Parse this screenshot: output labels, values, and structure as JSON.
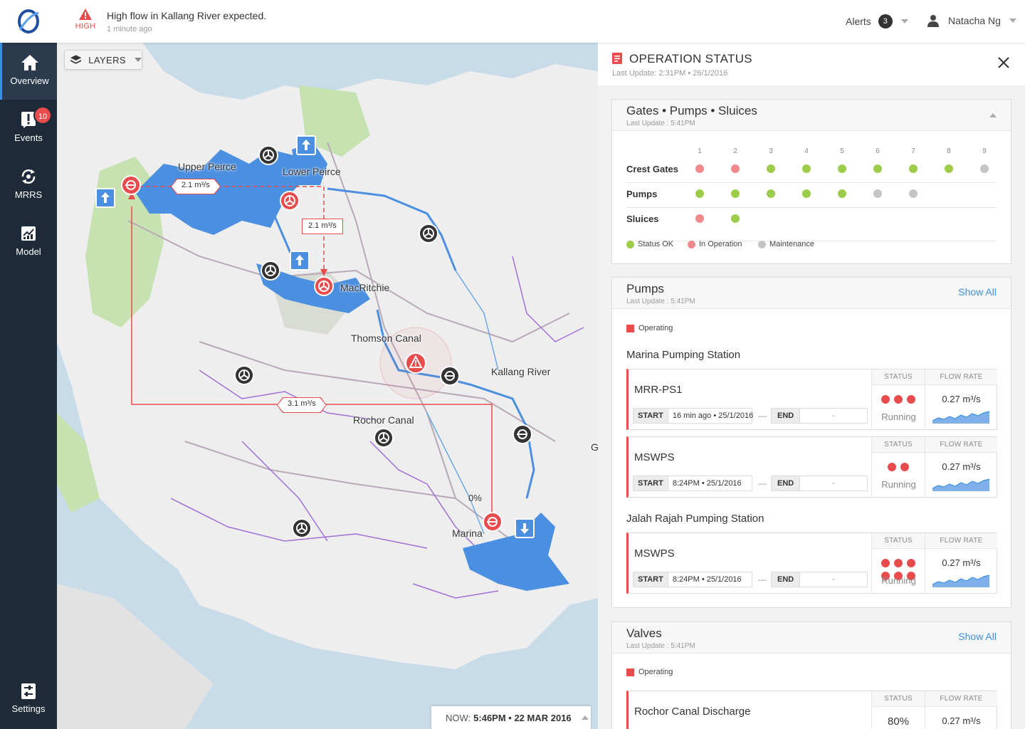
{
  "header": {
    "alert_level": "HIGH",
    "alert_message": "High flow in Kallang River expected.",
    "alert_time": "1 minute ago",
    "alerts_label": "Alerts",
    "alerts_count": "3",
    "user_name": "Natacha Ng"
  },
  "sidebar": {
    "items": [
      {
        "label": "Overview",
        "icon": "home-icon",
        "active": true
      },
      {
        "label": "Events",
        "icon": "exclamation-icon",
        "badge": "10"
      },
      {
        "label": "MRRS",
        "icon": "refresh-icon"
      },
      {
        "label": "Model",
        "icon": "bar-chart-icon"
      }
    ],
    "settings_label": "Settings"
  },
  "map": {
    "layers_label": "LAYERS",
    "places": {
      "upper_peirce": "Upper Peirce",
      "lower_peirce": "Lower Peirce",
      "macritchie": "MacRitchie",
      "thomson_canal": "Thomson Canal",
      "kallang_river": "Kallang River",
      "rochor_canal": "Rochor Canal",
      "marina": "Marina",
      "g_edge": "G"
    },
    "flows": {
      "flow1": "2.1 m³/s",
      "flow2": "2.1 m³/s",
      "flow3": "3.1 m³/s"
    },
    "percent": "0%",
    "now_label": "NOW:",
    "now_value": "5:46PM • 22 MAR 2016",
    "colors": {
      "water": "#4a8fe0",
      "land": "#eeeeee",
      "sea": "#c8dbe8",
      "park": "#c6e2b0",
      "alert": "#e84c4c"
    }
  },
  "panel": {
    "title": "OPERATION STATUS",
    "last_update": "Last Update: 2:31PM • 26/1/2016",
    "gps": {
      "title": "Gates • Pumps • Sluices",
      "update": "Last Update : 5:41PM",
      "columns": [
        "1",
        "2",
        "3",
        "4",
        "5",
        "6",
        "7",
        "8",
        "9"
      ],
      "rows": [
        {
          "label": "Crest Gates",
          "states": [
            "r",
            "r",
            "g",
            "g",
            "g",
            "g",
            "g",
            "g",
            "x"
          ]
        },
        {
          "label": "Pumps",
          "states": [
            "g",
            "g",
            "g",
            "g",
            "g",
            "x",
            "x"
          ]
        },
        {
          "label": "Sluices",
          "states": [
            "r",
            "g"
          ]
        }
      ],
      "legend": [
        "Status OK",
        "In Operation",
        "Maintenance"
      ]
    },
    "pumps": {
      "title": "Pumps",
      "update": "Last Update : 5:41PM",
      "show_all": "Show All",
      "operating": "Operating",
      "stations": [
        {
          "name": "Marina Pumping Station"
        },
        {
          "name": "Jalah Rajah  Pumping Station"
        }
      ],
      "units": [
        {
          "name": "MRR-PS1",
          "start": "16 min ago • 25/1/2016",
          "end": "-",
          "dots": 3,
          "status": "Running",
          "rate": "0.27 m³/s"
        },
        {
          "name": "MSWPS",
          "start": "8:24PM • 25/1/2016",
          "end": "-",
          "dots": 2,
          "status": "Running",
          "rate": "0.27 m³/s"
        },
        {
          "name": "MSWPS",
          "start": "8:24PM • 25/1/2016",
          "end": "-",
          "dots": 6,
          "status": "Running",
          "rate": "0.27 m³/s"
        }
      ],
      "labels": {
        "status": "STATUS",
        "flow_rate": "FLOW RATE",
        "start": "START",
        "end": "END"
      }
    },
    "valves": {
      "title": "Valves",
      "update": "Last Update : 5:41PM",
      "show_all": "Show All",
      "operating": "Operating",
      "unit_name": "Rochor Canal Discharge",
      "status_value": "80%",
      "rate": "0.27 m³/s"
    }
  }
}
